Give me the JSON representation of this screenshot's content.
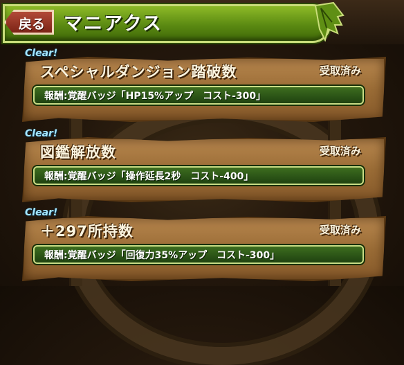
{
  "header": {
    "back_label": "戻る",
    "title": "マニアクス"
  },
  "missions": [
    {
      "clear_tag": "Clear!",
      "title": "スペシャルダンジョン踏破数",
      "status": "受取済み",
      "reward": "報酬:覚醒バッジ「HP15%アップ　コスト-300」"
    },
    {
      "clear_tag": "Clear!",
      "title": "図鑑解放数",
      "status": "受取済み",
      "reward": "報酬:覚醒バッジ「操作延長2秒　コスト-400」"
    },
    {
      "clear_tag": "Clear!",
      "title": "＋297所持数",
      "status": "受取済み",
      "reward": "報酬:覚醒バッジ「回復力35%アップ　コスト-300」"
    }
  ],
  "colors": {
    "header_green": "#6b9a18",
    "back_red": "#9a3624",
    "plank_brown": "#9a6c36",
    "reward_green": "#2d581a",
    "clear_blue": "#a6e7ff"
  }
}
